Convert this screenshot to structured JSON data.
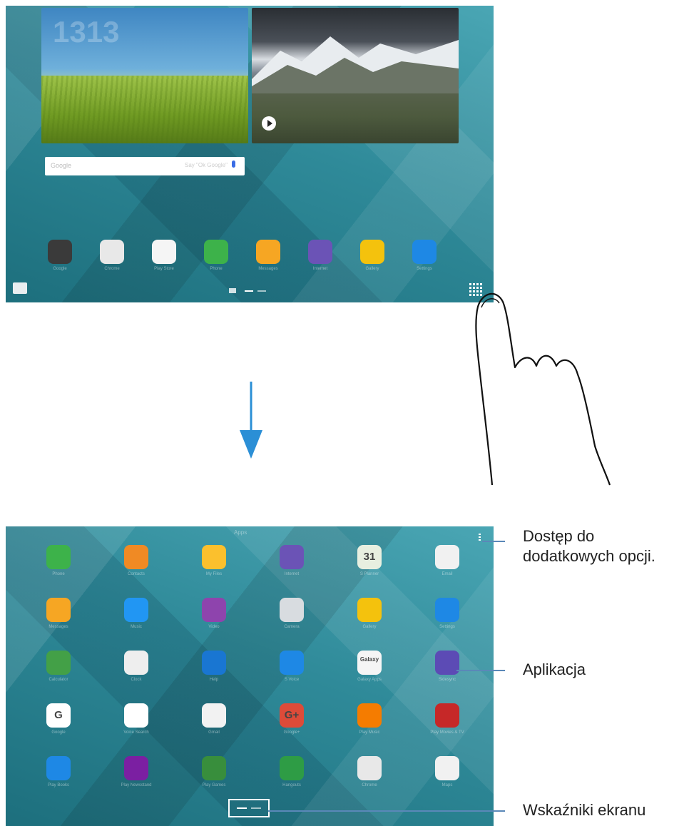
{
  "home_screen": {
    "widget_clock_time": "1313",
    "search_placeholder": "Google",
    "search_hint": "Say \"Ok Google\"",
    "dock": [
      {
        "label": "Google",
        "icon": "google-folder-icon",
        "color": "#3a3a3a"
      },
      {
        "label": "Chrome",
        "icon": "chrome-icon",
        "color": "#e8e8e8"
      },
      {
        "label": "Play Store",
        "icon": "play-store-icon",
        "color": "#f5f5f5"
      },
      {
        "label": "Phone",
        "icon": "phone-icon",
        "color": "#3db24a"
      },
      {
        "label": "Messages",
        "icon": "messages-icon",
        "color": "#f6a623"
      },
      {
        "label": "Internet",
        "icon": "internet-icon",
        "color": "#6b53b6"
      },
      {
        "label": "Gallery",
        "icon": "gallery-icon",
        "color": "#f4c20d"
      },
      {
        "label": "Settings",
        "icon": "settings-icon",
        "color": "#1e88e5"
      }
    ]
  },
  "apps_screen": {
    "title": "Apps",
    "rows": [
      [
        {
          "label": "Phone",
          "icon": "phone-icon",
          "color": "#3db24a"
        },
        {
          "label": "Contacts",
          "icon": "contacts-icon",
          "color": "#f08a24"
        },
        {
          "label": "My Files",
          "icon": "my-files-icon",
          "color": "#fbc02d"
        },
        {
          "label": "Internet",
          "icon": "internet-icon",
          "color": "#6b53b6"
        },
        {
          "label": "S Planner",
          "icon": "calendar-icon",
          "color": "#e8efe0",
          "text": "31"
        },
        {
          "label": "Email",
          "icon": "email-icon",
          "color": "#f1f1f1"
        }
      ],
      [
        {
          "label": "Messages",
          "icon": "messages-icon",
          "color": "#f6a623"
        },
        {
          "label": "Music",
          "icon": "music-icon",
          "color": "#2196f3"
        },
        {
          "label": "Video",
          "icon": "video-icon",
          "color": "#8e44ad"
        },
        {
          "label": "Camera",
          "icon": "camera-icon",
          "color": "#d8dce0"
        },
        {
          "label": "Gallery",
          "icon": "gallery-icon",
          "color": "#f4c20d"
        },
        {
          "label": "Settings",
          "icon": "settings-icon",
          "color": "#1e88e5"
        }
      ],
      [
        {
          "label": "Calculator",
          "icon": "calculator-icon",
          "color": "#43a047"
        },
        {
          "label": "Clock",
          "icon": "clock-icon",
          "color": "#eeeeee"
        },
        {
          "label": "Help",
          "icon": "help-icon",
          "color": "#1976d2"
        },
        {
          "label": "S Voice",
          "icon": "s-voice-icon",
          "color": "#1e88e5"
        },
        {
          "label": "Galaxy Apps",
          "icon": "galaxy-apps-icon",
          "color": "#f5f5f5",
          "text": "Galaxy"
        },
        {
          "label": "Sidesync",
          "icon": "sidesync-icon",
          "color": "#5c4bb5"
        }
      ],
      [
        {
          "label": "Google",
          "icon": "google-icon",
          "color": "#ffffff",
          "text": "G"
        },
        {
          "label": "Voice Search",
          "icon": "voice-search-icon",
          "color": "#ffffff"
        },
        {
          "label": "Gmail",
          "icon": "gmail-icon",
          "color": "#f2f2f2"
        },
        {
          "label": "Google+",
          "icon": "google-plus-icon",
          "color": "#dd4b39",
          "text": "G+"
        },
        {
          "label": "Play Music",
          "icon": "play-music-icon",
          "color": "#f57c00"
        },
        {
          "label": "Play Movies & TV",
          "icon": "play-movies-icon",
          "color": "#c62828"
        }
      ],
      [
        {
          "label": "Play Books",
          "icon": "play-books-icon",
          "color": "#1e88e5"
        },
        {
          "label": "Play Newsstand",
          "icon": "play-newsstand-icon",
          "color": "#7b1fa2"
        },
        {
          "label": "Play Games",
          "icon": "play-games-icon",
          "color": "#388e3c"
        },
        {
          "label": "Hangouts",
          "icon": "hangouts-icon",
          "color": "#2e9c45"
        },
        {
          "label": "Chrome",
          "icon": "chrome-icon",
          "color": "#e8e8e8"
        },
        {
          "label": "Maps",
          "icon": "maps-icon",
          "color": "#f1f1f1"
        }
      ]
    ]
  },
  "callouts": {
    "more_options": "Dostęp do dodatkowych opcji.",
    "application": "Aplikacja",
    "screen_indicators": "Wskaźniki ekranu"
  },
  "colors": {
    "arrow": "#2b8fd6",
    "callout_line": "#5a88b8"
  }
}
